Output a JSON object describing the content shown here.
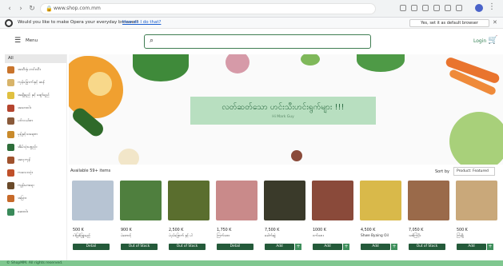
{
  "browser": {
    "url": "www.shop.com.mm",
    "nav_back": "‹",
    "nav_forward": "›",
    "nav_reload": "↻",
    "menu": "⋮"
  },
  "infobar": {
    "message": "Would you like to make Opera your everyday browser?",
    "link": "How do I do that?",
    "dismiss": "Yes, set it as default browser",
    "close": "✕"
  },
  "header": {
    "menu_icon": "☰",
    "menu_label": "Menu",
    "search_placeholder": "",
    "search_icon": "⌕",
    "login": "Login",
    "cart_icon": "🛒"
  },
  "sidebar": {
    "all_label": "All",
    "items": [
      {
        "label": "အသီးနှံ ဟင်းသီး",
        "color": "#c9742b"
      },
      {
        "label": "ကုန်ခြောက်နှင့် ဆန်",
        "color": "#d8b46a"
      },
      {
        "label": "အချိုရည် နှင့် ဖျော်ရည်",
        "color": "#e0c040"
      },
      {
        "label": "အသားငါး",
        "color": "#b5452f"
      },
      {
        "label": "ပင်လယ်စာ",
        "color": "#8a5a3a"
      },
      {
        "label": "မုန့်နှင့်သရေစာ",
        "color": "#c98a2b"
      },
      {
        "label": "အိမ်သုံးပစ္စည်း",
        "color": "#2d6e3a"
      },
      {
        "label": "အလှကုန်",
        "color": "#a0522d"
      },
      {
        "label": "ကလေးသုံး",
        "color": "#c0502a"
      },
      {
        "label": "ကျန်းမာရေး",
        "color": "#6a4a2a"
      },
      {
        "label": "အခြား",
        "color": "#c76a2a"
      },
      {
        "label": "ဆေးဝါး",
        "color": "#3a8a5a"
      }
    ]
  },
  "banner": {
    "title": "လတ်ဆတ်သော ဟင်းသီးဟင်းရွက်များ !!!",
    "subtitle": "Hi Mark Guy"
  },
  "products": {
    "available": "Available 59+ items",
    "sort_label": "Sort by",
    "sort_value": "Product: Featured",
    "items": [
      {
        "price": "500 K",
        "name": "ငါးမြစ်ခြူးမည်",
        "button": "Detail",
        "has_plus": false,
        "img": "#b7c4d3"
      },
      {
        "price": "900 K",
        "name": "ပဲတောင့်",
        "button": "Out of Stock",
        "has_plus": false,
        "img": "#4f7f3e"
      },
      {
        "price": "2,500 K",
        "name": "ပဲပုပ်ခြောက် နှင့် ပါ",
        "button": "Out of Stock",
        "has_plus": false,
        "img": "#5a6e2e"
      },
      {
        "price": "1,750 K",
        "name": "ကြက်သား",
        "button": "Detail",
        "has_plus": false,
        "img": "#c98a8a"
      },
      {
        "price": "7,500 K",
        "name": "ခေါက်ဆွဲ",
        "button": "Add",
        "has_plus": true,
        "img": "#3a3a2a"
      },
      {
        "price": "1000 K",
        "name": "ဝက်သား",
        "button": "Add",
        "has_plus": true,
        "img": "#8a4a3a"
      },
      {
        "price": "4,500 K",
        "name": "Shwe Byaing Oil",
        "button": "Add",
        "has_plus": true,
        "img": "#d9b94a"
      },
      {
        "price": "7,050 K",
        "name": "သစ်ကြံပိုး",
        "button": "Out of Stock",
        "has_plus": false,
        "img": "#9a6a4a"
      },
      {
        "price": "500 K",
        "name": "ကြံချို",
        "button": "Add",
        "has_plus": true,
        "img": "#c9a87a"
      }
    ]
  },
  "footer": {
    "text": "© ShopMM. All rights reserved."
  }
}
